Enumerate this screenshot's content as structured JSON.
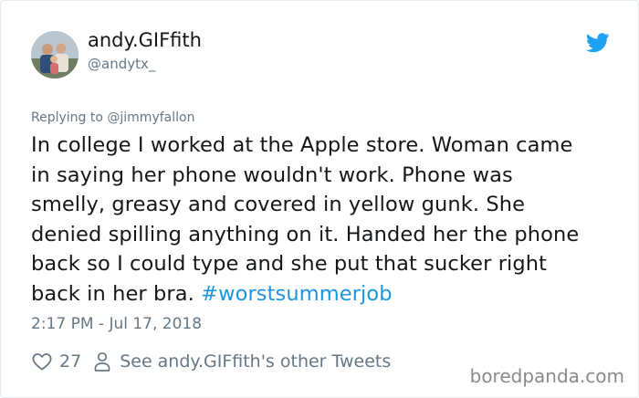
{
  "user": {
    "display_name": "andy.GIFfith",
    "handle": "@andytx_"
  },
  "reply": {
    "prefix": "Replying to ",
    "mention": "@jimmyfallon"
  },
  "tweet": {
    "line1": "In college I worked at the Apple store. Woman came",
    "line2": "in saying her phone wouldn't work. Phone was",
    "line3": "smelly, greasy and covered in yellow gunk. She",
    "line4": "denied spilling anything on it. Handed her the phone",
    "line5": "back so I could type and she put that sucker right",
    "line6_prefix": "back in her bra. ",
    "hashtag": "#worstsummerjob",
    "timestamp": "2:17 PM - Jul 17, 2018"
  },
  "actions": {
    "like_count": "27",
    "profile_link": "See andy.GIFfith's other Tweets"
  },
  "watermark": "boredpanda.com",
  "colors": {
    "text": "#14171a",
    "secondary": "#657786",
    "link": "#1b95e0",
    "twitter_blue": "#1da1f2"
  },
  "icons": [
    "twitter-bird-icon",
    "heart-icon",
    "person-icon"
  ]
}
